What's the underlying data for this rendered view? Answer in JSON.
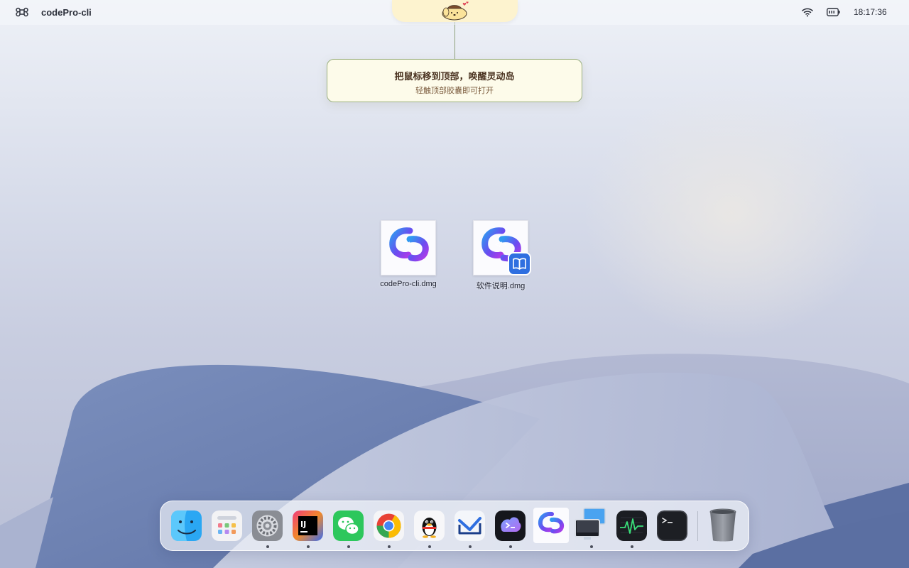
{
  "menubar": {
    "app_name": "codePro-cli",
    "clock": "18:17:36",
    "icons": [
      "command-icon",
      "wifi-icon",
      "battery-icon"
    ]
  },
  "island": {
    "mascot": "pompompurin-mascot-icon"
  },
  "tooltip": {
    "title": "把鼠标移到顶部，唤醒灵动岛",
    "subtitle": "轻触顶部胶囊即可打开"
  },
  "desktop": {
    "items": [
      {
        "label": "codePro-cli.dmg",
        "icon": "codepro-logo-icon"
      },
      {
        "label": "软件说明.dmg",
        "icon": "codepro-logo-icon",
        "badge": "book-icon"
      }
    ]
  },
  "dock": {
    "items": [
      {
        "name": "finder",
        "running": false
      },
      {
        "name": "launchpad",
        "running": false
      },
      {
        "name": "system-settings",
        "running": true
      },
      {
        "name": "intellij-idea",
        "running": true
      },
      {
        "name": "wechat",
        "running": true
      },
      {
        "name": "chrome",
        "running": true
      },
      {
        "name": "qq",
        "running": true
      },
      {
        "name": "mail",
        "running": true
      },
      {
        "name": "ai-assistant",
        "running": true
      },
      {
        "name": "codepro",
        "running": false
      },
      {
        "name": "network-screens",
        "running": true
      },
      {
        "name": "activity-monitor",
        "running": true
      },
      {
        "name": "terminal",
        "running": false
      },
      {
        "name": "trash",
        "running": false
      }
    ]
  },
  "colors": {
    "accent": "#2f6fe0",
    "island": "#fdf3cf",
    "tooltip_border": "#9bb080"
  }
}
